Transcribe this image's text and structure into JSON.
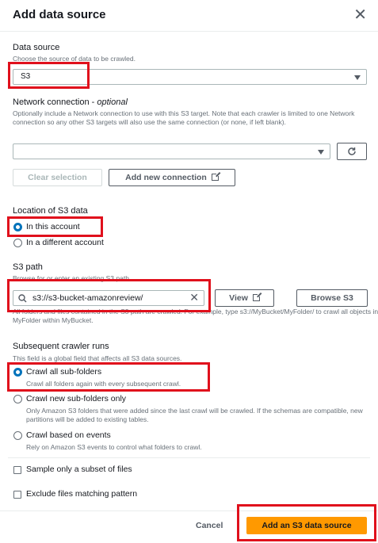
{
  "header": {
    "title": "Add data source"
  },
  "data_source": {
    "label": "Data source",
    "desc": "Choose the source of data to be crawled.",
    "value": "S3"
  },
  "network": {
    "label": "Network connection - ",
    "label_optional": "optional",
    "desc": "Optionally include a Network connection to use with this S3 target. Note that each crawler is limited to one Network connection so any other S3 targets will also use the same connection (or none, if left blank).",
    "value": "",
    "clear_label": "Clear selection",
    "add_label": "Add new connection"
  },
  "location": {
    "label": "Location of S3 data",
    "options": [
      "In this account",
      "In a different account"
    ],
    "selected": 0
  },
  "s3_path": {
    "label": "S3 path",
    "desc": "Browse for or enter an existing S3 path.",
    "value": "s3://s3-bucket-amazonreview/",
    "view_label": "View",
    "browse_label": "Browse S3",
    "help": "All folders and files contained in the S3 path are crawled. For example, type s3://MyBucket/MyFolder/ to crawl all objects in MyFolder within MyBucket."
  },
  "subsequent": {
    "label": "Subsequent crawler runs",
    "desc": "This field is a global field that affects all S3 data sources.",
    "options": [
      {
        "label": "Crawl all sub-folders",
        "desc": "Crawl all folders again with every subsequent crawl."
      },
      {
        "label": "Crawl new sub-folders only",
        "desc": "Only Amazon S3 folders that were added since the last crawl will be crawled. If the schemas are compatible, new partitions will be added to existing tables."
      },
      {
        "label": "Crawl based on events",
        "desc": "Rely on Amazon S3 events to control what folders to crawl."
      }
    ],
    "selected": 0
  },
  "checks": {
    "sample": "Sample only a subset of files",
    "exclude": "Exclude files matching pattern"
  },
  "footer": {
    "cancel_label": "Cancel",
    "submit_label": "Add an S3 data source"
  },
  "colors": {
    "accent": "#0073bb",
    "primary": "#ff9900",
    "highlight": "#e0101c"
  }
}
